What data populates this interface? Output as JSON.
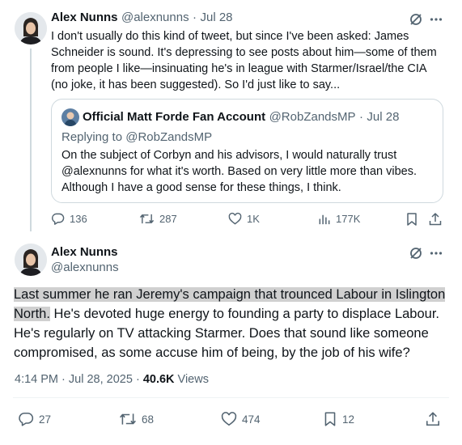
{
  "tweet1": {
    "name": "Alex Nunns",
    "handle": "@alexnunns",
    "dot": "·",
    "date": "Jul 28",
    "text": "I don't usually do this kind of tweet, but since I've been asked: James Schneider is sound. It's depressing to see posts about him—some of them from people I like—insinuating he's in league with Starmer/Israel/the CIA (no joke, it has been suggested). So I'd just like to say...",
    "quote": {
      "name": "Official Matt Forde Fan Account",
      "handle": "@RobZandsMP",
      "dot": "·",
      "date": "Jul 28",
      "replying_prefix": "Replying to ",
      "replying_to": "@RobZandsMP",
      "text": "On the subject of Corbyn and his advisors, I would naturally trust @alexnunns for what it's worth. Based on very little more than vibes. Although I have a good sense for these things, I think."
    },
    "actions": {
      "replies": "136",
      "reposts": "287",
      "likes": "1K",
      "views": "177K"
    }
  },
  "tweet2": {
    "name": "Alex Nunns",
    "handle": "@alexnunns",
    "text_highlighted": "Last summer he ran Jeremy's campaign that trounced Labour in Islington North.",
    "text_rest": " He's devoted huge energy to founding a party to displace Labour. He's regularly on TV attacking Starmer. Does that sound like someone compromised, as some accuse him of being, by the job of his wife?",
    "timestamp": "4:14 PM · Jul 28, 2025",
    "dot": "·",
    "views_count": "40.6K",
    "views_label": " Views",
    "actions": {
      "replies": "27",
      "reposts": "68",
      "likes": "474",
      "bookmarks": "12"
    }
  },
  "icons": [
    "grok-icon",
    "more-icon",
    "reply-icon",
    "repost-icon",
    "like-icon",
    "views-icon",
    "bookmark-icon",
    "share-icon"
  ],
  "colors": {
    "text": "#0f1419",
    "secondary": "#536471",
    "border": "#cfd9de",
    "highlight": "#d0d0d0"
  }
}
